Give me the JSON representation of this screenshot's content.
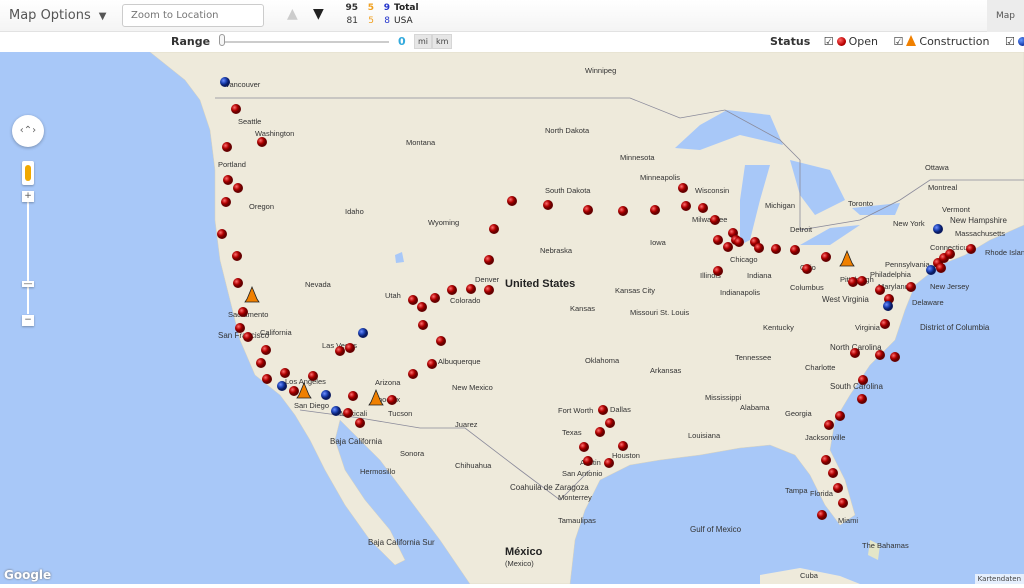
{
  "toolbar": {
    "map_options": "Map Options",
    "chevron_icon": "chevron-down-icon",
    "zoom_placeholder": "Zoom to Location",
    "up_icon": "chevron-up-icon",
    "down_icon": "chevron-down-icon",
    "map_tab": "Map"
  },
  "counts": {
    "total": {
      "open": "95",
      "construction": "5",
      "other": "9",
      "label": "Total"
    },
    "usa": {
      "open": "81",
      "construction": "5",
      "other": "8",
      "label": "USA"
    }
  },
  "range": {
    "label": "Range",
    "value": "0",
    "units": [
      "mi",
      "km"
    ],
    "slider_value": 0
  },
  "status": {
    "label": "Status",
    "filters": [
      {
        "label": "Open",
        "checked": true,
        "color": "#cc0000"
      },
      {
        "label": "Construction",
        "checked": true,
        "color": "#f08000"
      },
      {
        "label": "",
        "checked": true,
        "color": "#1a3fb0"
      }
    ]
  },
  "map": {
    "colors": {
      "water": "#a8c8f8",
      "land": "#eeeadb"
    },
    "labels": [
      "Winnipeg",
      "Vancouver",
      "Seattle",
      "Washington",
      "Portland",
      "Oregon",
      "Montana",
      "Idaho",
      "North Dakota",
      "South Dakota",
      "Minnesota",
      "Minneapolis",
      "Wisconsin",
      "Michigan",
      "Milwaukee",
      "Chicago",
      "Detroit",
      "Toronto",
      "Ottawa",
      "Montreal",
      "Vermont",
      "New Hampshire",
      "Massachusetts",
      "New York",
      "Connecticut",
      "Rhode Island",
      "New Jersey",
      "Pennsylvania",
      "Philadelphia",
      "Pittsburgh",
      "Delaware",
      "Maryland",
      "District of Columbia",
      "Wyoming",
      "Nebraska",
      "Iowa",
      "Illinois",
      "Indiana",
      "Ohio",
      "Columbus",
      "Indianapolis",
      "West Virginia",
      "Virginia",
      "Kentucky",
      "Nevada",
      "Utah",
      "Colorado",
      "Denver",
      "United States",
      "Kansas",
      "Kansas City",
      "Missouri",
      "St. Louis",
      "Sacramento",
      "San Francisco",
      "California",
      "Las Vegas",
      "Los Angeles",
      "San Diego",
      "Mexicali",
      "Arizona",
      "Phoenix",
      "Tucson",
      "Albuquerque",
      "New Mexico",
      "Oklahoma",
      "Tennessee",
      "Arkansas",
      "North Carolina",
      "Charlotte",
      "South Carolina",
      "Georgia",
      "Alabama",
      "Mississippi",
      "Texas",
      "Dallas",
      "Fort Worth",
      "Austin",
      "Houston",
      "San Antonio",
      "Louisiana",
      "Jacksonville",
      "Florida",
      "Tampa",
      "Miami",
      "Baja California",
      "Sonora",
      "Chihuahua",
      "Hermosillo",
      "Juarez",
      "Coahuila de Zaragoza",
      "Monterrey",
      "Tamaulipas",
      "México",
      "(Mexico)",
      "Baja California Sur",
      "Gulf of Mexico",
      "The Bahamas",
      "Cuba"
    ],
    "google": "Google",
    "attribution": "Kartendaten"
  }
}
